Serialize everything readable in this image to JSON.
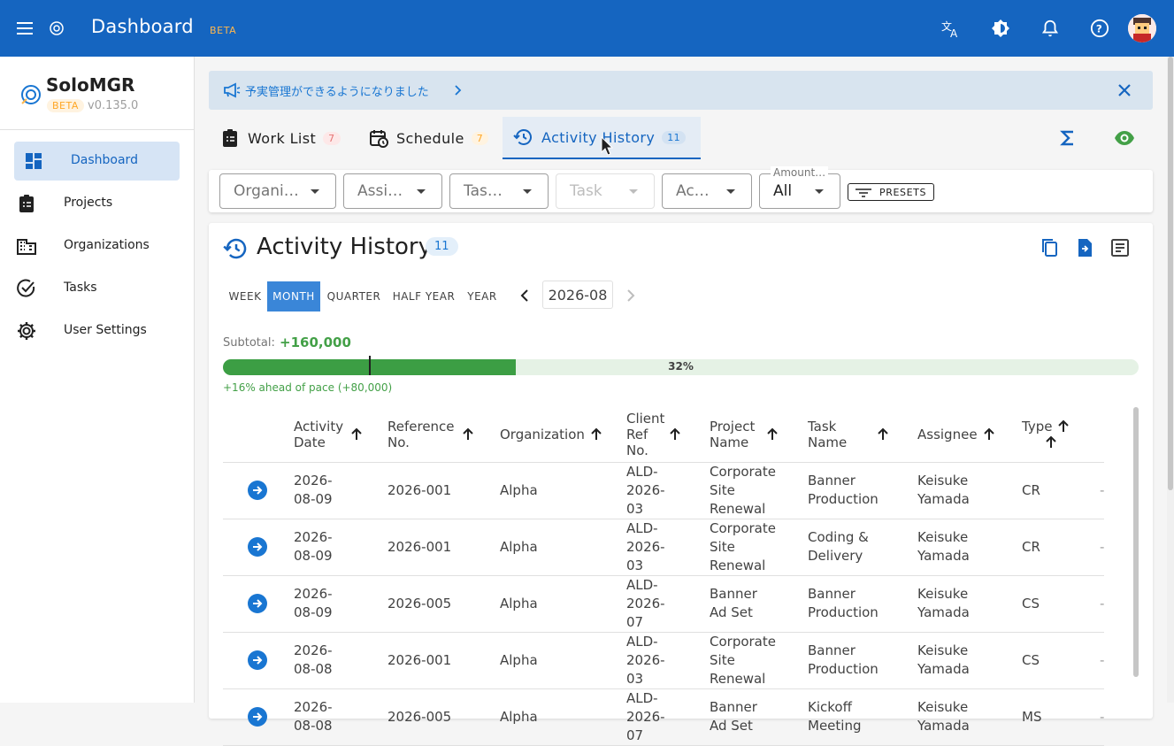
{
  "appbar": {
    "title": "Dashboard",
    "beta": "BETA"
  },
  "brand": {
    "name": "SoloMGR",
    "beta": "BETA",
    "version": "v0.135.0"
  },
  "nav": {
    "items": [
      {
        "label": "Dashboard",
        "icon": "dashboard-icon",
        "active": true
      },
      {
        "label": "Projects",
        "icon": "clipboard-icon"
      },
      {
        "label": "Organizations",
        "icon": "building-icon"
      },
      {
        "label": "Tasks",
        "icon": "check-circle-icon"
      },
      {
        "label": "User Settings",
        "icon": "gear-icon"
      }
    ]
  },
  "announcement": {
    "text": "予実管理ができるようになりました"
  },
  "tabs": [
    {
      "label": "Work List",
      "count": "7"
    },
    {
      "label": "Schedule",
      "count": "7"
    },
    {
      "label": "Activity History",
      "count": "11"
    }
  ],
  "filters": {
    "organization": "Organi…",
    "assignee": "Assi…",
    "task_type": "Tas…",
    "task": "Task",
    "activity": "Ac…",
    "amount_label": "Amount…",
    "amount": "All",
    "presets": "PRESETS"
  },
  "card": {
    "title": "Activity History",
    "count": "11",
    "periods": [
      "WEEK",
      "MONTH",
      "QUARTER",
      "HALF YEAR",
      "YEAR"
    ],
    "active_period": "MONTH",
    "current_period": "2026-08",
    "subtotal_label": "Subtotal:",
    "subtotal_value": "+160,000",
    "progress_percent": 32,
    "progress_label": "32%",
    "pace_text": "+16% ahead of pace (+80,000)"
  },
  "table": {
    "headers": [
      "Activity Date",
      "Reference No.",
      "Organization",
      "Client Ref No.",
      "Project Name",
      "Task Name",
      "Assignee",
      "Type"
    ],
    "rows": [
      [
        "2026-08-09",
        "2026-001",
        "Alpha",
        "ALD-2026-03",
        "Corporate Site Renewal",
        "Banner Production",
        "Keisuke Yamada",
        "CR"
      ],
      [
        "2026-08-09",
        "2026-001",
        "Alpha",
        "ALD-2026-03",
        "Corporate Site Renewal",
        "Coding & Delivery",
        "Keisuke Yamada",
        "CR"
      ],
      [
        "2026-08-09",
        "2026-005",
        "Alpha",
        "ALD-2026-07",
        "Banner Ad Set",
        "Banner Production",
        "Keisuke Yamada",
        "CS"
      ],
      [
        "2026-08-08",
        "2026-001",
        "Alpha",
        "ALD-2026-03",
        "Corporate Site Renewal",
        "Banner Production",
        "Keisuke Yamada",
        "CS"
      ],
      [
        "2026-08-08",
        "2026-005",
        "Alpha",
        "ALD-2026-07",
        "Banner Ad Set",
        "Kickoff Meeting",
        "Keisuke Yamada",
        "MS"
      ]
    ]
  },
  "colors": {
    "primary": "#1565c0",
    "accent_green": "#43a047",
    "beta_orange": "#ffb74d"
  }
}
